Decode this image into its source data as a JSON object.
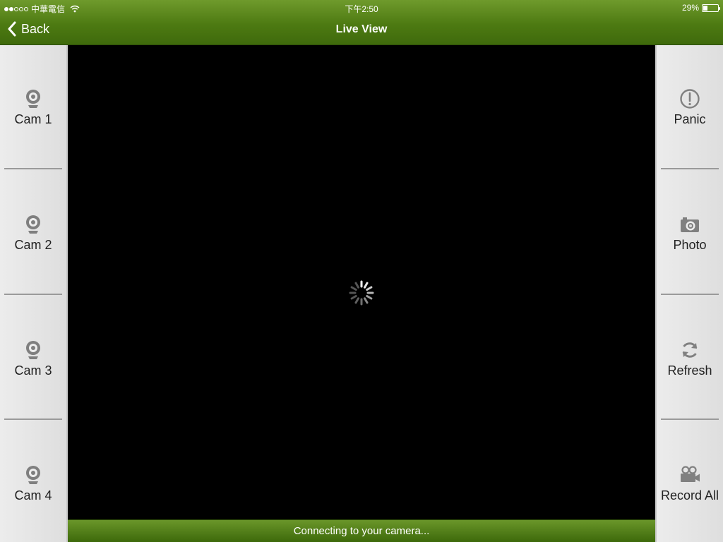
{
  "status_bar": {
    "carrier": "中華電信",
    "time": "下午2:50",
    "battery": "29%",
    "battery_level": 0.29
  },
  "nav": {
    "back_label": "Back",
    "title": "Live View"
  },
  "left_panel": {
    "items": [
      {
        "label": "Cam 1",
        "icon": "webcam-icon"
      },
      {
        "label": "Cam 2",
        "icon": "webcam-icon"
      },
      {
        "label": "Cam 3",
        "icon": "webcam-icon"
      },
      {
        "label": "Cam 4",
        "icon": "webcam-icon"
      }
    ]
  },
  "right_panel": {
    "items": [
      {
        "label": "Panic",
        "icon": "alert-icon"
      },
      {
        "label": "Photo",
        "icon": "camera-icon"
      },
      {
        "label": "Refresh",
        "icon": "refresh-icon"
      },
      {
        "label": "Record All",
        "icon": "video-camera-icon"
      }
    ]
  },
  "video": {
    "status_message": "Connecting to your camera..."
  },
  "colors": {
    "header_green": "#4d7a12",
    "panel_bg": "#e6e6e6",
    "icon_gray": "#808080"
  }
}
